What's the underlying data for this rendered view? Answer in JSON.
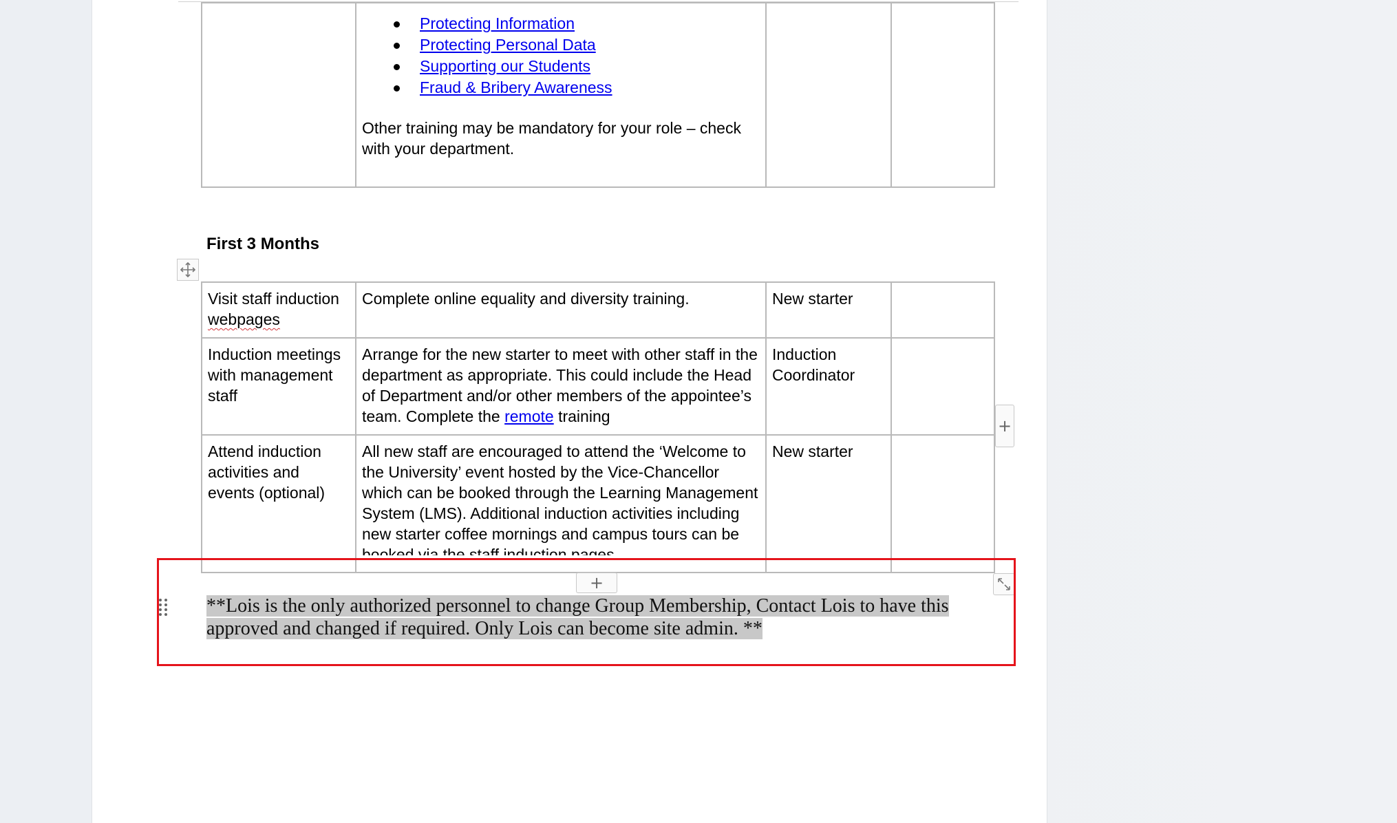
{
  "top_table": {
    "links": [
      "Protecting Information",
      "Protecting Personal Data",
      "Supporting our Students",
      "Fraud & Bribery Awareness"
    ],
    "note": "Other training may be mandatory for your role – check with your department."
  },
  "section_heading": "First 3 Months",
  "months_table": {
    "rows": [
      {
        "task_parts": [
          "Visit staff induction ",
          "webpages"
        ],
        "description": "Complete online equality and diversity training.",
        "owner": "New starter",
        "status": ""
      },
      {
        "task": "Induction meetings with management staff",
        "description_before": "Arrange for the new starter to meet with other staff in the department as appropriate. This could include the Head of Department and/or other members of the appointee’s team. Complete the ",
        "description_link": "remote",
        "description_after": " training",
        "owner": "Induction Coordinator",
        "status": ""
      },
      {
        "task": "Attend induction activities and events (optional)",
        "description": "All new staff are encouraged to attend the ‘Welcome to the University’ event hosted by the Vice-Chancellor which can be booked through the Learning Management System (LMS). Additional induction activities including new starter coffee mornings and campus tours can be booked via the staff induction pages",
        "owner": "New starter",
        "status": ""
      }
    ]
  },
  "highlighted_note": "**Lois is the only authorized personnel to change Group Membership, Contact Lois to have this approved and changed if required. Only Lois can become site admin. ** ",
  "controls": {
    "add_column": "+",
    "add_row": "+"
  },
  "colors": {
    "link": "#0000ee",
    "highlight_border": "#e5141b",
    "selection": "#c8c8c8"
  }
}
